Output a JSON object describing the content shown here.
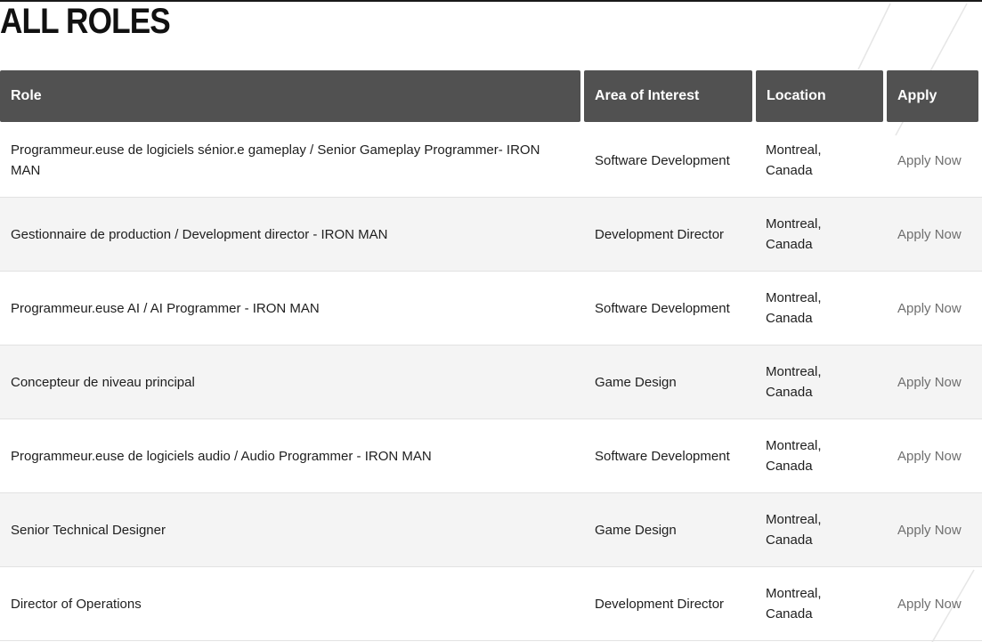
{
  "page": {
    "title": "ALL ROLES"
  },
  "table": {
    "headers": {
      "role": "Role",
      "area": "Area of Interest",
      "location": "Location",
      "apply": "Apply"
    },
    "rows": [
      {
        "role": "Programmeur.euse de logiciels sénior.e gameplay / Senior Gameplay Programmer- IRON MAN",
        "area": "Software Development",
        "location": "Montreal, Canada",
        "apply": "Apply Now"
      },
      {
        "role": "Gestionnaire de production / Development director - IRON MAN",
        "area": "Development Director",
        "location": "Montreal, Canada",
        "apply": "Apply Now"
      },
      {
        "role": "Programmeur.euse AI / AI Programmer - IRON MAN",
        "area": "Software Development",
        "location": "Montreal, Canada",
        "apply": "Apply Now"
      },
      {
        "role": "Concepteur de niveau principal",
        "area": "Game Design",
        "location": "Montreal, Canada",
        "apply": "Apply Now"
      },
      {
        "role": "Programmeur.euse de logiciels audio / Audio Programmer - IRON MAN",
        "area": "Software Development",
        "location": "Montreal, Canada",
        "apply": "Apply Now"
      },
      {
        "role": "Senior Technical Designer",
        "area": "Game Design",
        "location": "Montreal, Canada",
        "apply": "Apply Now"
      },
      {
        "role": "Director of Operations",
        "area": "Development Director",
        "location": "Montreal, Canada",
        "apply": "Apply Now"
      }
    ]
  }
}
